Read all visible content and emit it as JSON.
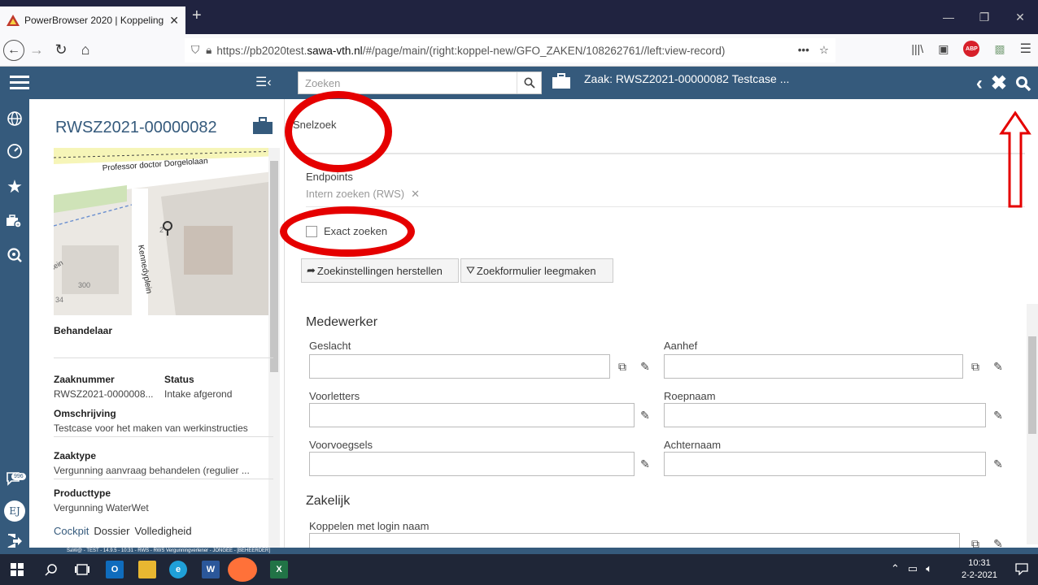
{
  "browser": {
    "tab_title": "PowerBrowser 2020 | Koppeling",
    "tab_close": "✕",
    "new_tab": "+",
    "url_prefix": "https://pb2020test.",
    "url_domain": "sawa-vth.nl",
    "url_suffix": "/#/page/main/(right:koppel-new/GFO_ZAKEN/108262761//left:view-record)",
    "url_more": "•••"
  },
  "header": {
    "search_placeholder": "Zoeken",
    "zaak_title": "Zaak: RWSZ2021-00000082 Testcase ..."
  },
  "left": {
    "record_id": "RWSZ2021-00000082",
    "map": {
      "street1": "Professor doctor Dorgelolaan",
      "street2": "Kennedyplein",
      "num300": "300",
      "num34": "34",
      "num2": "2",
      "lein": "lein"
    },
    "behandelaar_label": "Behandelaar",
    "zaaknummer_label": "Zaaknummer",
    "zaaknummer_value": "RWSZ2021-0000008...",
    "status_label": "Status",
    "status_value": "Intake afgerond",
    "omschrijving_label": "Omschrijving",
    "omschrijving_value": "Testcase voor het maken van werkinstructies",
    "zaaktype_label": "Zaaktype",
    "zaaktype_value": "Vergunning aanvraag behandelen (regulier ...",
    "producttype_label": "Producttype",
    "producttype_value": "Vergunning WaterWet",
    "tabs": [
      "Cockpit",
      "Dossier",
      "Volledigheid"
    ]
  },
  "rail": {
    "badge": "996",
    "avatar": "EJ"
  },
  "form": {
    "snelzoek_label": "Snelzoek",
    "endpoints_label": "Endpoints",
    "endpoint_chip": "Intern zoeken (RWS)",
    "exact_label": "Exact zoeken",
    "reset_btn": "Zoekinstellingen herstellen",
    "clear_btn": "Zoekformulier leegmaken",
    "medewerker_title": "Medewerker",
    "geslacht_label": "Geslacht",
    "aanhef_label": "Aanhef",
    "voorletters_label": "Voorletters",
    "roepnaam_label": "Roepnaam",
    "voorvoegsels_label": "Voorvoegsels",
    "achternaam_label": "Achternaam",
    "zakelijk_title": "Zakelijk",
    "koppelen_label": "Koppelen met login naam"
  },
  "status_bar": "SaW@ - TEST - 14.9.5 - 10:31 - RWS - RWS Vergunningverlener - JONGEE - [BEHEERDER]",
  "taskbar": {
    "time": "10:31",
    "date": "2-2-2021"
  },
  "colors": {
    "header": "#355a7c",
    "annotation": "#e50000"
  }
}
